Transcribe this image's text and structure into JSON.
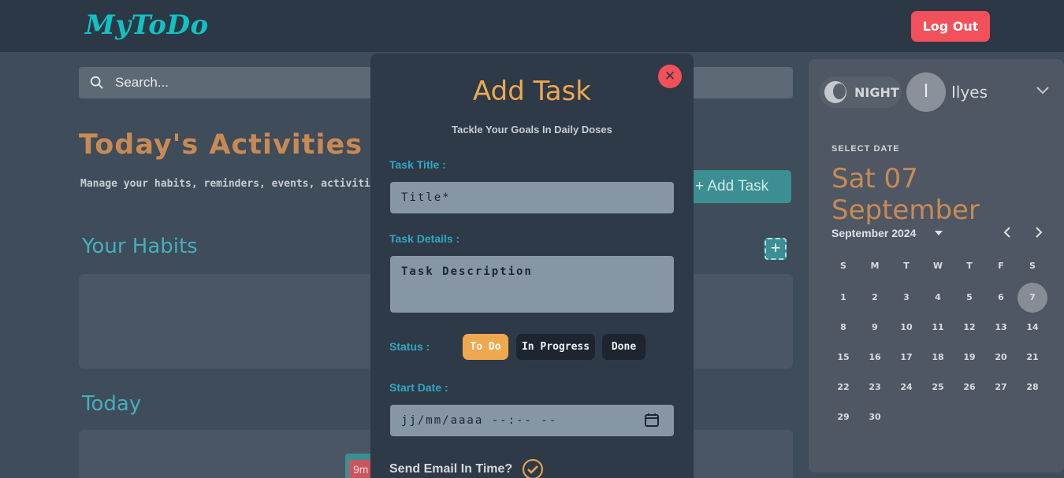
{
  "header": {
    "logo": "MyToDo",
    "logout_label": "Log Out"
  },
  "search": {
    "placeholder": "Search..."
  },
  "main": {
    "title": "Today's Activities",
    "subtitle": "Manage your habits, reminders, events, activities",
    "add_task_label": "Add Task",
    "habits_heading": "Your Habits",
    "today_heading": "Today",
    "chip_text": "9m"
  },
  "sidebar": {
    "theme_label": "NIGHT",
    "avatar_letter": "I",
    "username": "Ilyes",
    "select_date_label": "SELECT DATE",
    "selected_date": "Sat 07 September",
    "month_label": "September 2024",
    "weekdays": [
      "S",
      "M",
      "T",
      "W",
      "T",
      "F",
      "S"
    ],
    "days": [
      "1",
      "2",
      "3",
      "4",
      "5",
      "6",
      "7",
      "8",
      "9",
      "10",
      "11",
      "12",
      "13",
      "14",
      "15",
      "16",
      "17",
      "18",
      "19",
      "20",
      "21",
      "22",
      "23",
      "24",
      "25",
      "26",
      "27",
      "28",
      "29",
      "30"
    ],
    "selected_day": "7"
  },
  "modal": {
    "title": "Add Task",
    "subtitle": "Tackle Your Goals In Daily Doses",
    "task_title_label": "Task Title :",
    "task_title_placeholder": "Title*",
    "task_details_label": "Task Details :",
    "task_details_placeholder": "Task Description",
    "status_label": "Status :",
    "status_options": [
      "To Do",
      "In Progress",
      "Done"
    ],
    "start_date_label": "Start Date :",
    "start_date_placeholder": "jj/mm/aaaa --:-- --",
    "email_label": "Send Email In Time?",
    "close_glyph": "✕"
  },
  "colors": {
    "accent": "#f0a84e",
    "brand": "#12c2c2",
    "danger": "#f2505a",
    "teal": "#3b8e92"
  }
}
